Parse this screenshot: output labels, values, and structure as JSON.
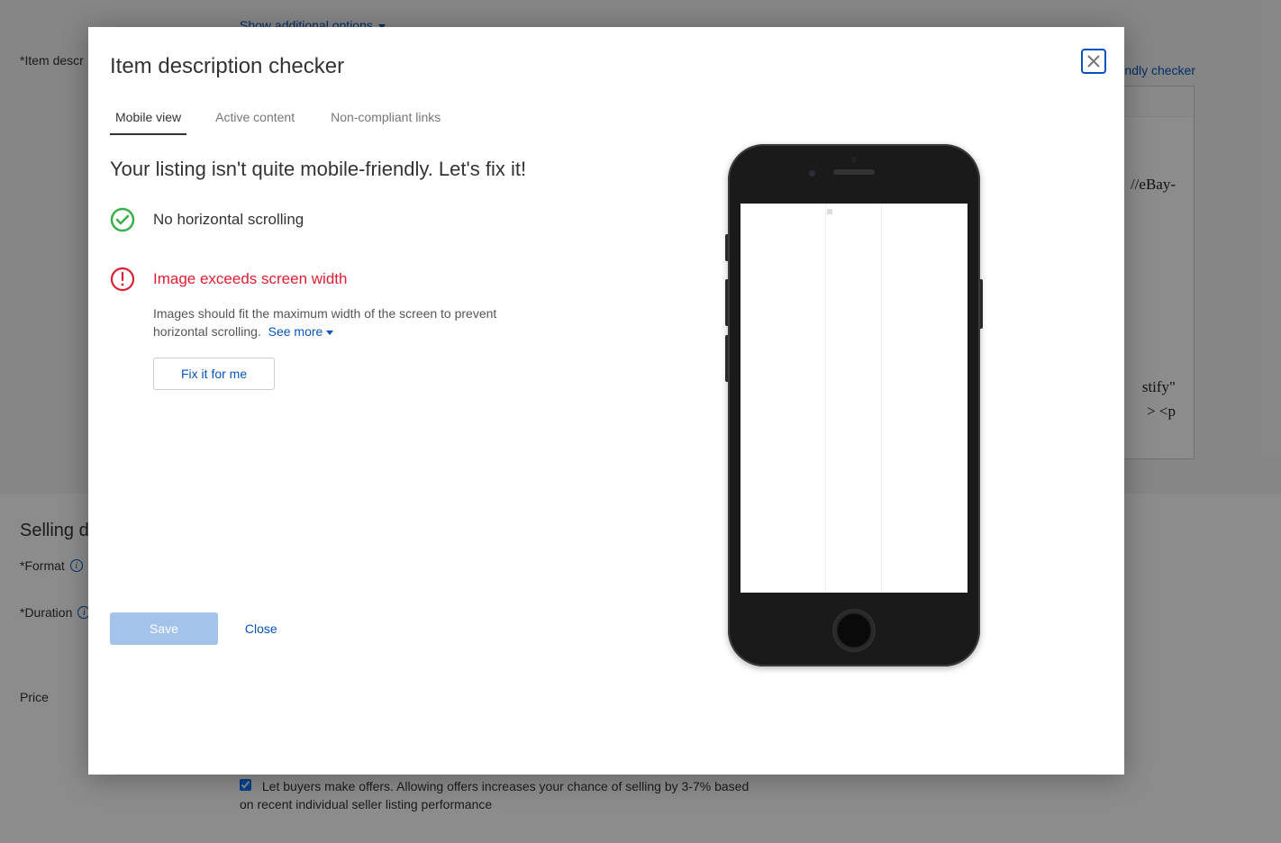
{
  "background": {
    "show_additional": "Show additional options",
    "item_desc_label": "*Item descr",
    "friendly_checker": "ndly checker",
    "desc_line1": "//eBay-",
    "desc_line2_a": "stify\"",
    "desc_line2_b": "> <p",
    "selling_d": "Selling de",
    "format_label": "*Format",
    "duration_label": "*Duration",
    "price_label": "Price",
    "offers_text": "Let buyers make offers. Allowing offers increases your chance of selling by 3-7% based on recent individual seller listing performance"
  },
  "modal": {
    "title": "Item description checker",
    "tabs": {
      "mobile": "Mobile view",
      "active": "Active content",
      "links": "Non-compliant links"
    },
    "heading": "Your listing isn't quite mobile-friendly. Let's fix it!",
    "check_ok": "No horizontal scrolling",
    "check_err_title": "Image exceeds screen width",
    "check_err_desc": "Images should fit the maximum width of the screen to prevent horizontal scrolling.",
    "see_more": "See more",
    "fix_it": "Fix it for me",
    "save": "Save",
    "close": "Close"
  }
}
